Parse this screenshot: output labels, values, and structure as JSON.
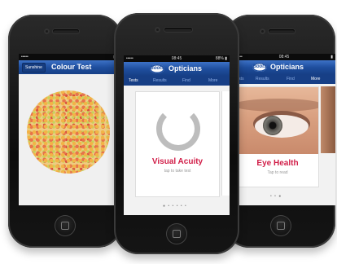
{
  "phone_left": {
    "status": {
      "bars": "•••••",
      "time": "",
      "battery": "▮"
    },
    "back_button": "Sunshine",
    "title": "Colour Test"
  },
  "phone_center": {
    "status": {
      "bars": "•••••",
      "time": "08:45",
      "battery": "88% ▮"
    },
    "logo_text": "Boots",
    "title": "Opticians",
    "tabs": [
      "Tests",
      "Results",
      "Find",
      "More"
    ],
    "active_tab": "Tests",
    "card_title": "Visual Acuity",
    "card_subtitle": "tap to take test",
    "page_dots": "● • • • • •",
    "accent_color": "#d11e48"
  },
  "phone_right": {
    "status": {
      "bars": "•••••",
      "time": "08:45",
      "battery": "▮"
    },
    "logo_text": "Boots",
    "title": "Opticians",
    "tabs": [
      "Tests",
      "Results",
      "Find",
      "More"
    ],
    "active_tab": "More",
    "card_title": "Eye Health",
    "card_subtitle": "Tap to read",
    "page_dots": "• • ●"
  }
}
